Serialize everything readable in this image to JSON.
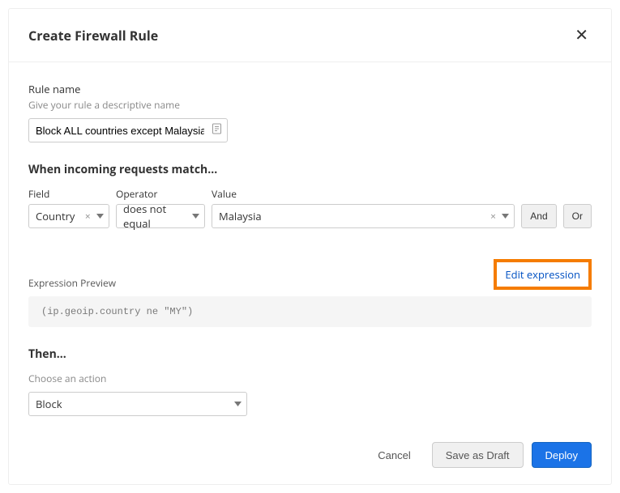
{
  "header": {
    "title": "Create Firewall Rule",
    "close": "✕"
  },
  "ruleName": {
    "label": "Rule name",
    "help": "Give your rule a descriptive name",
    "value": "Block ALL countries except Malaysia"
  },
  "match": {
    "title": "When incoming requests match…",
    "fieldLabel": "Field",
    "operatorLabel": "Operator",
    "valueLabel": "Value",
    "field": "Country",
    "operator": "does not equal",
    "value": "Malaysia",
    "and": "And",
    "or": "Or"
  },
  "preview": {
    "label": "Expression Preview",
    "editLink": "Edit expression",
    "code": "(ip.geoip.country ne \"MY\")"
  },
  "then": {
    "title": "Then…",
    "help": "Choose an action",
    "value": "Block"
  },
  "footer": {
    "cancel": "Cancel",
    "draft": "Save as Draft",
    "deploy": "Deploy"
  }
}
